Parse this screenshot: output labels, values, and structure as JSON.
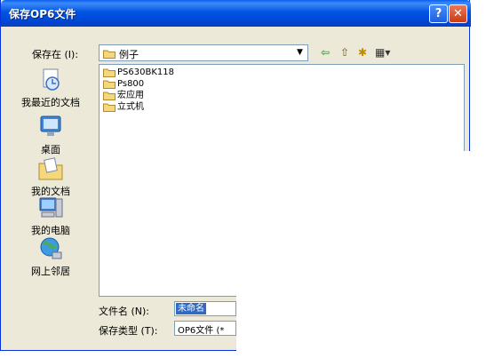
{
  "window": {
    "title": "保存OP6文件"
  },
  "titlebar": {
    "help_label": "?",
    "close_label": "✕"
  },
  "save_in": {
    "label": "保存在 (I):",
    "current_folder": "例子"
  },
  "toolbar": {
    "back": "⇦",
    "up": "⇧",
    "new_folder": "✱",
    "view": "▦▾"
  },
  "places": [
    {
      "label": "我最近的文档",
      "icon": "recent-documents-icon"
    },
    {
      "label": "桌面",
      "icon": "desktop-icon"
    },
    {
      "label": "我的文档",
      "icon": "my-documents-icon"
    },
    {
      "label": "我的电脑",
      "icon": "my-computer-icon"
    },
    {
      "label": "网上邻居",
      "icon": "network-places-icon"
    }
  ],
  "files": [
    {
      "name": "PS630BK118",
      "icon": "folder-icon"
    },
    {
      "name": "Ps800",
      "icon": "folder-icon"
    },
    {
      "name": "宏应用",
      "icon": "folder-icon"
    },
    {
      "name": "立式机",
      "icon": "folder-icon"
    }
  ],
  "filename": {
    "label": "文件名 (N):",
    "value": "未命名"
  },
  "filetype": {
    "label": "保存类型 (T):",
    "value": "OP6文件 (*"
  },
  "colors": {
    "title_blue": "#0054e3",
    "face": "#ece9d8",
    "selection": "#316ac5",
    "folder": "#f5d87c"
  }
}
